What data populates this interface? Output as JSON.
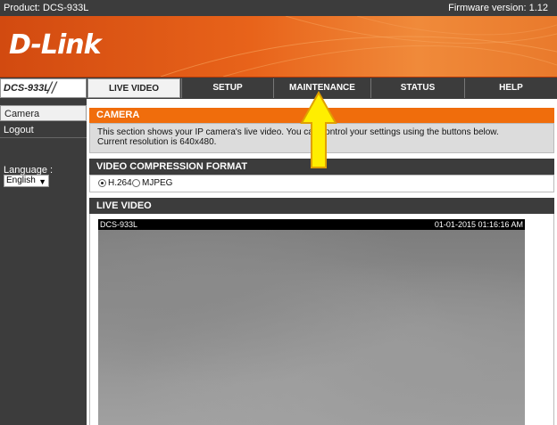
{
  "topbar": {
    "product": "Product: DCS-933L",
    "firmware": "Firmware version: 1.12"
  },
  "brand": {
    "logo": "D-Link"
  },
  "model": "DCS-933L",
  "nav": {
    "tabs": [
      {
        "label": "LIVE VIDEO",
        "active": true
      },
      {
        "label": "SETUP",
        "active": false
      },
      {
        "label": "MAINTENANCE",
        "active": false
      },
      {
        "label": "STATUS",
        "active": false
      },
      {
        "label": "HELP",
        "active": false
      }
    ]
  },
  "sidebar": {
    "items": [
      {
        "label": "Camera"
      },
      {
        "label": "Logout"
      }
    ],
    "language_label": "Language :",
    "language_value": "English"
  },
  "camera_section": {
    "title": "CAMERA",
    "line1": "This section shows your IP camera's live video. You can control your settings using the buttons below.",
    "line2": "Current resolution is 640x480."
  },
  "compression_section": {
    "title": "VIDEO COMPRESSION FORMAT",
    "options": [
      {
        "label": "H.264",
        "selected": true
      },
      {
        "label": "MJPEG",
        "selected": false
      }
    ]
  },
  "live_section": {
    "title": "LIVE VIDEO",
    "overlay_name": "DCS-933L",
    "overlay_timestamp": "01-01-2015 01:16:16 AM"
  },
  "colors": {
    "accent": "#f06d0c",
    "dark": "#3c3c3c",
    "highlight_arrow": "#ffee00"
  }
}
